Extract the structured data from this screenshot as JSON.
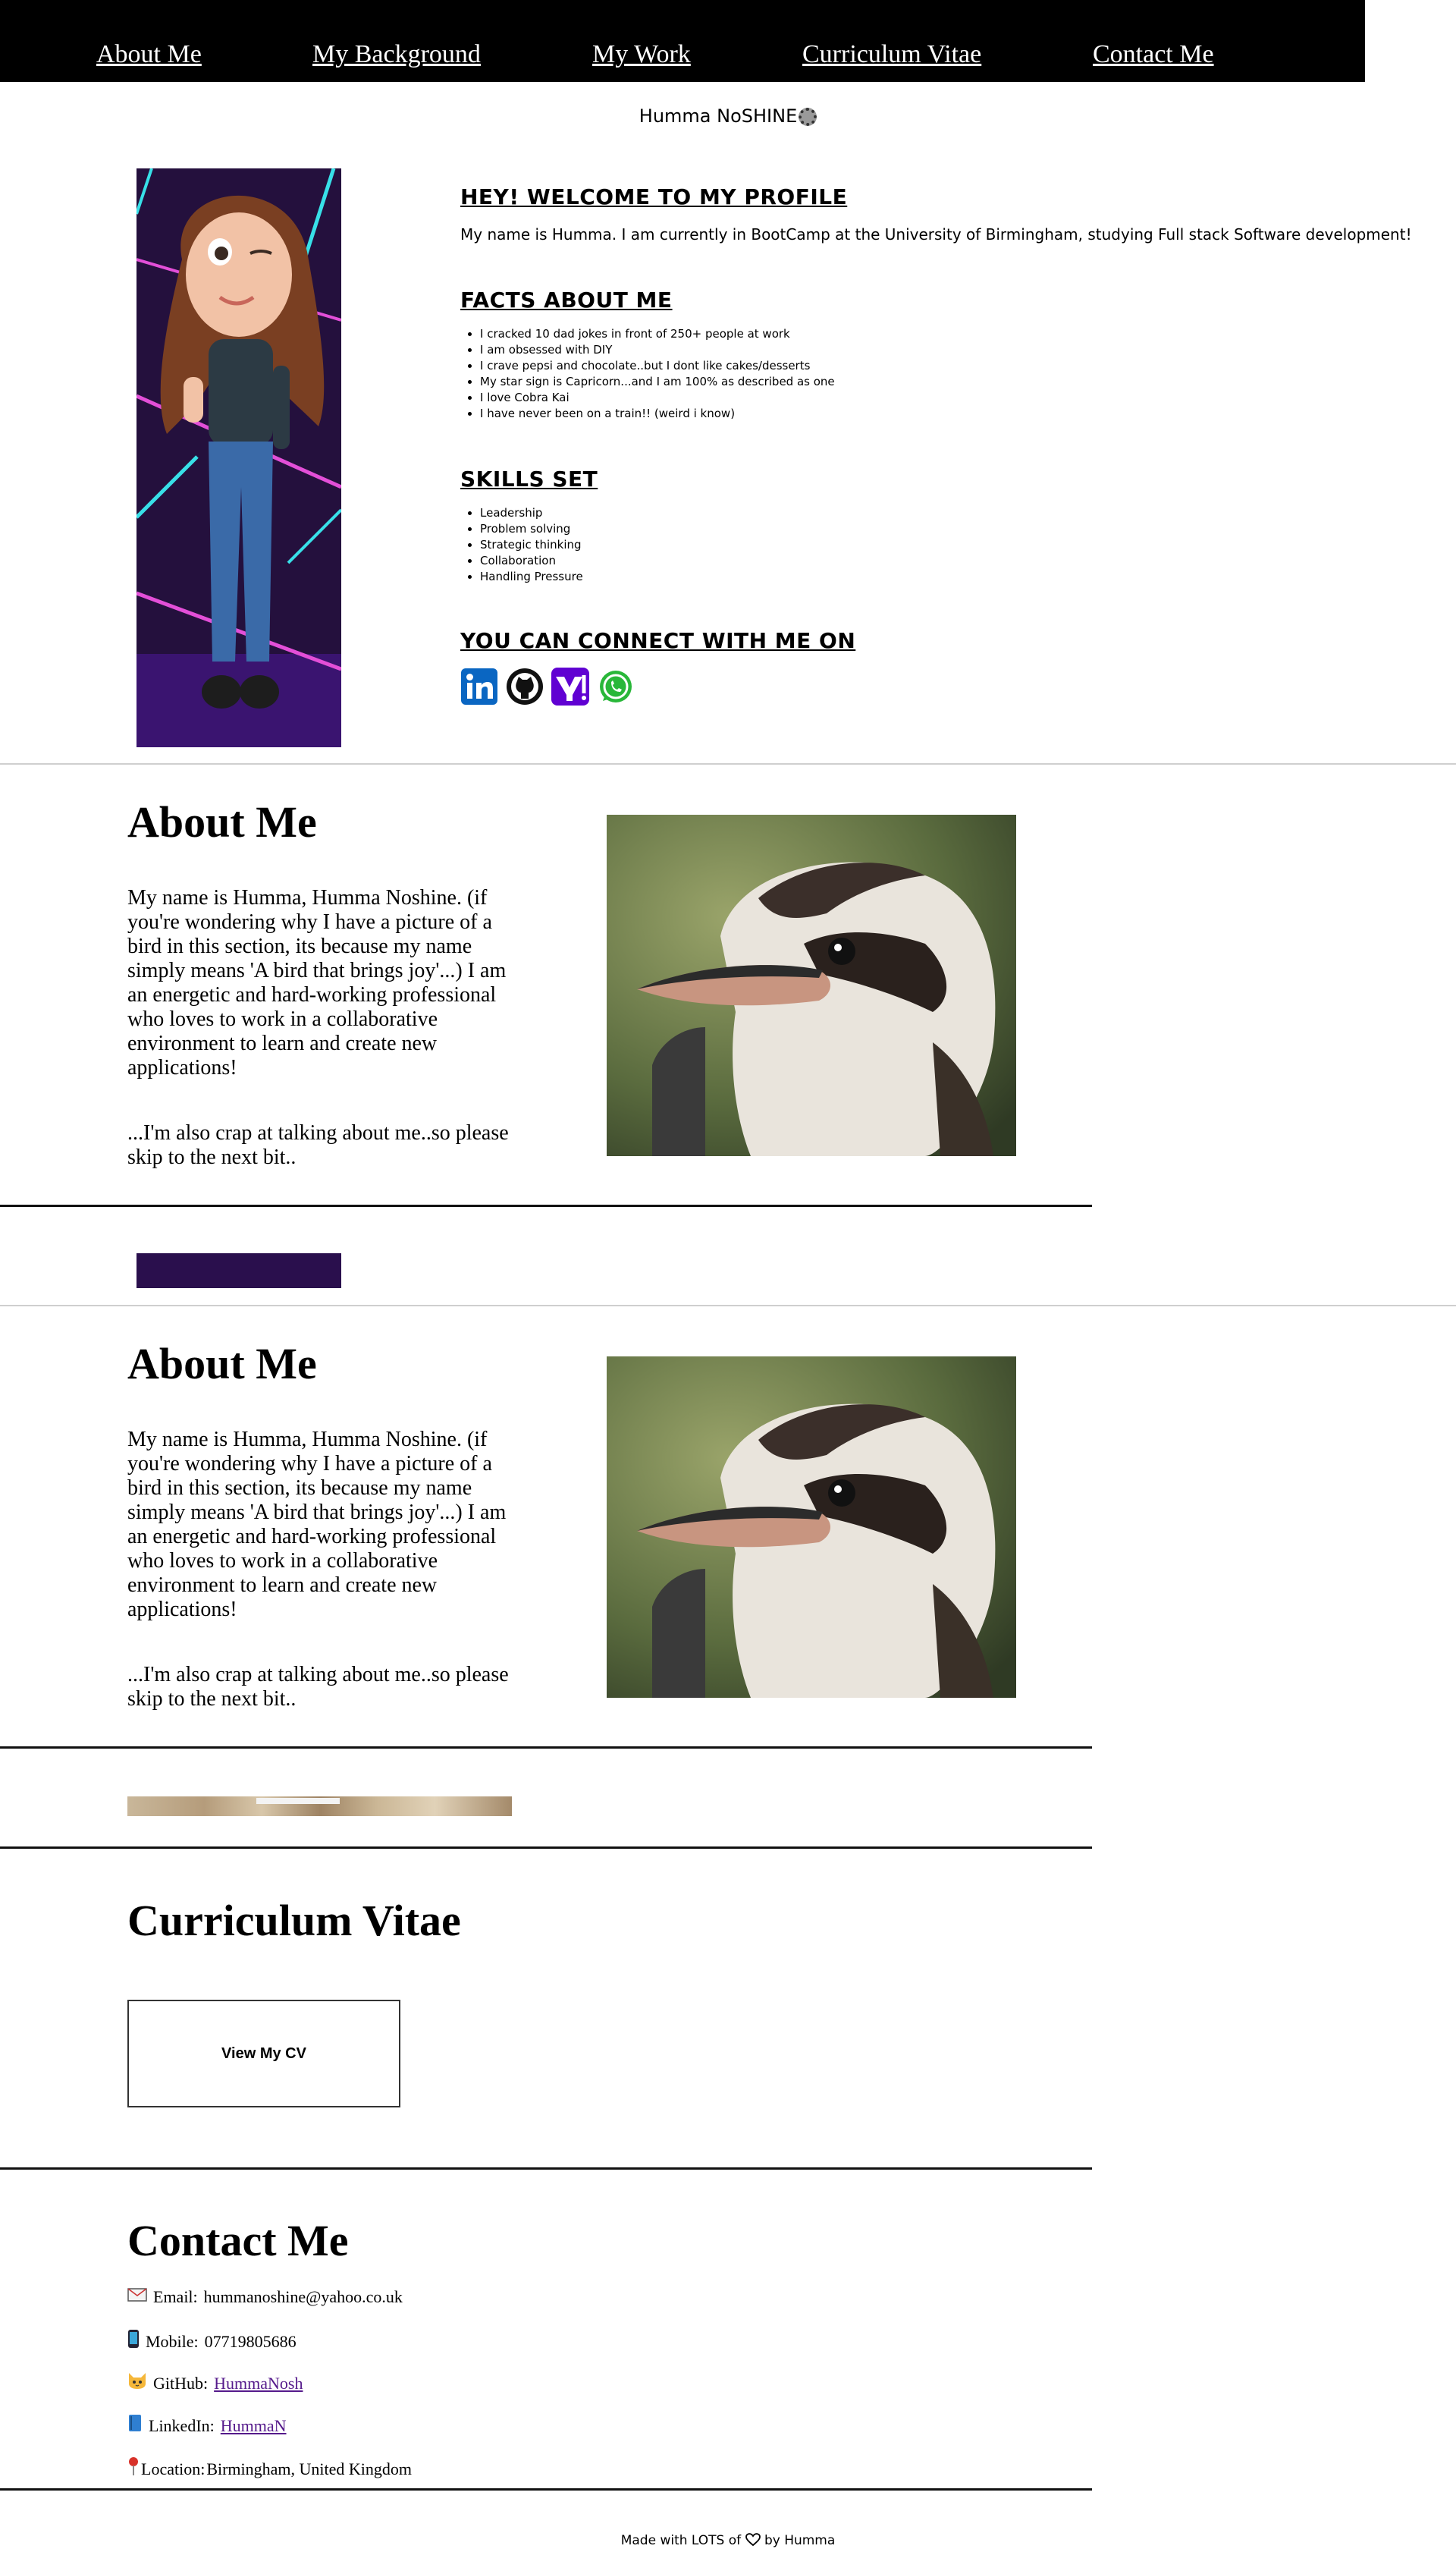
{
  "nav": {
    "items": [
      {
        "label": "About Me"
      },
      {
        "label": "My Background"
      },
      {
        "label": "My Work"
      },
      {
        "label": "Curriculum Vitae"
      },
      {
        "label": "Contact Me"
      }
    ]
  },
  "brand": {
    "name": "Humma NoSHINE",
    "icon": "gear-icon"
  },
  "profile": {
    "welcome_heading": "HEY! WELCOME TO MY PROFILE",
    "welcome_text": "My name is Humma. I am currently in BootCamp at the University of Birmingham, studying Full stack Software development!",
    "facts_heading": "FACTS ABOUT ME",
    "facts": [
      "I cracked 10 dad jokes in front of 250+ people at work",
      "I am obsessed with DIY",
      "I crave pepsi and chocolate..but I dont like cakes/desserts",
      "My star sign is Capricorn...and I am 100% as described as one",
      "I love Cobra Kai",
      "I have never been on a train!! (weird i know)"
    ],
    "skills_heading": "SKILLS SET",
    "skills": [
      "Leadership",
      "Problem solving",
      "Strategic thinking",
      "Collaboration",
      "Handling Pressure"
    ],
    "connect_heading": "YOU CAN CONNECT WITH ME ON",
    "social_icons": [
      "linkedin-icon",
      "github-icon",
      "yahoo-icon",
      "whatsapp-icon"
    ]
  },
  "about": {
    "heading": "About Me",
    "para1": "My name is Humma, Humma Noshine. (if you're wondering why I have a picture of a bird in this section, its because my name simply means 'A bird that brings joy'...) I am an energetic and hard-working professional who loves to work in a collaborative environment to learn and create new applications!",
    "para2": "...I'm also crap at talking about me..so please skip to the next bit.."
  },
  "cv": {
    "heading": "Curriculum Vitae",
    "button_label": "View My CV"
  },
  "contact": {
    "heading": "Contact Me",
    "email_label": "Email:",
    "email": "hummanoshine@yahoo.co.uk",
    "mobile_label": "Mobile:",
    "mobile": "07719805686",
    "github_label": "GitHub:",
    "github": "HummaNosh",
    "linkedin_label": "LinkedIn:",
    "linkedin": "HummaN",
    "location_label": "Location:",
    "location": "Birmingham, United Kingdom"
  },
  "footer": {
    "prefix": "Made with LOTS of",
    "suffix": "by Humma"
  },
  "colors": {
    "nav_bg": "#000000",
    "link_visited": "#551a8b"
  }
}
